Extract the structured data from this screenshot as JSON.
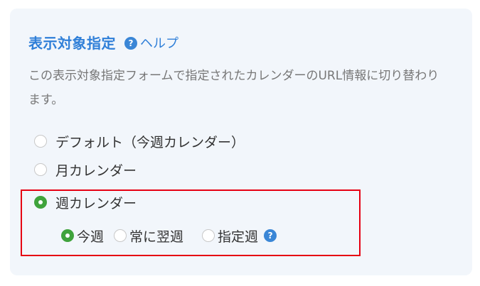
{
  "header": {
    "title": "表示対象指定",
    "help_icon": "question-circle-icon",
    "help_label": "ヘルプ"
  },
  "description": "この表示対象指定フォームで指定されたカレンダーのURL情報に切り替わります。",
  "options": [
    {
      "label": "デフォルト（今週カレンダー）",
      "checked": false
    },
    {
      "label": "月カレンダー",
      "checked": false
    },
    {
      "label": "週カレンダー",
      "checked": true
    }
  ],
  "week_options": [
    {
      "label": "今週",
      "checked": true
    },
    {
      "label": "常に翌週",
      "checked": false
    },
    {
      "label": "指定週",
      "checked": false
    }
  ],
  "week_help_icon": "question-circle-icon",
  "colors": {
    "accent": "#2f7fd8",
    "radio_checked": "#3fa33c",
    "highlight_border": "#e60012",
    "panel_background": "#f2f6fb"
  }
}
